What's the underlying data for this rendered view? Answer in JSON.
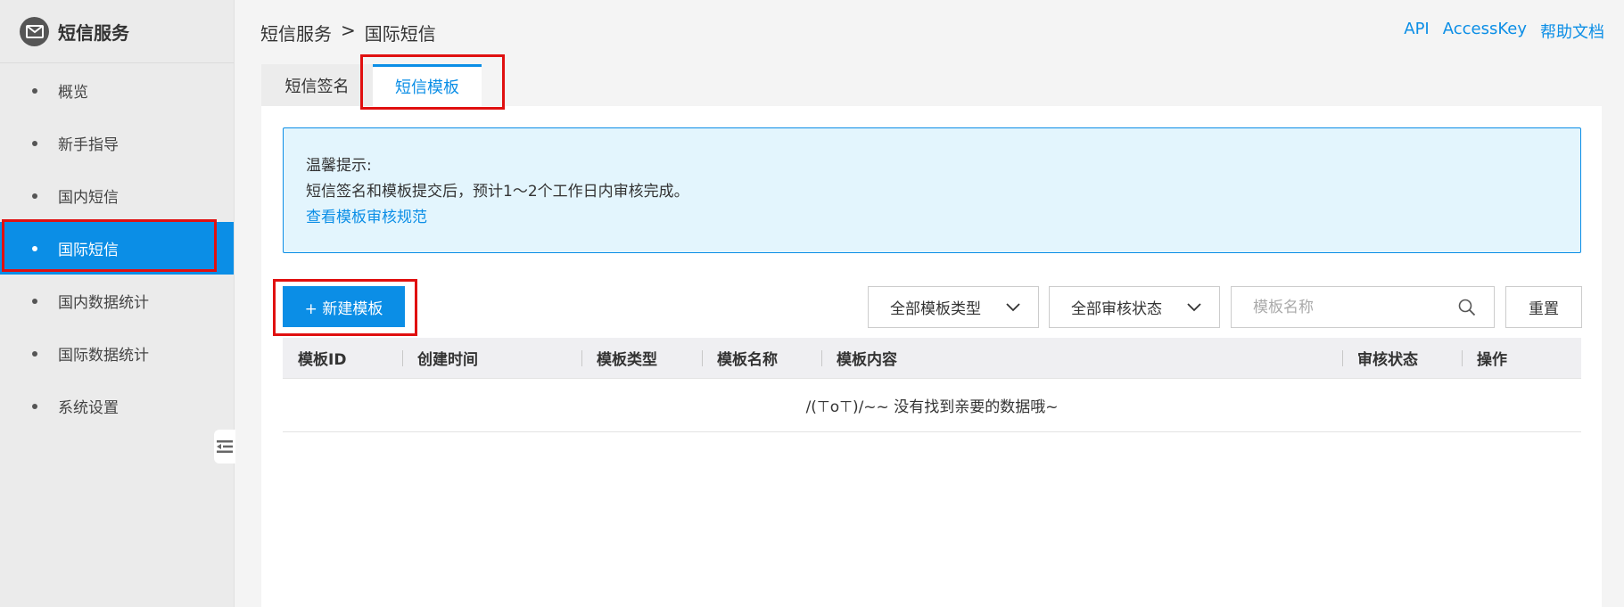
{
  "sidebar": {
    "title": "短信服务",
    "items": [
      {
        "label": "概览",
        "active": false
      },
      {
        "label": "新手指导",
        "active": false
      },
      {
        "label": "国内短信",
        "active": false
      },
      {
        "label": "国际短信",
        "active": true
      },
      {
        "label": "国内数据统计",
        "active": false
      },
      {
        "label": "国际数据统计",
        "active": false
      },
      {
        "label": "系统设置",
        "active": false
      }
    ]
  },
  "breadcrumb": {
    "root": "短信服务",
    "separator": ">",
    "current": "国际短信"
  },
  "top_links": [
    "API",
    "AccessKey",
    "帮助文档"
  ],
  "tabs": [
    {
      "label": "短信签名",
      "active": false
    },
    {
      "label": "短信模板",
      "active": true
    }
  ],
  "notice": {
    "title": "温馨提示:",
    "text": "短信签名和模板提交后，预计1～2个工作日内审核完成。",
    "link": "查看模板审核规范"
  },
  "toolbar": {
    "new_label": "+ 新建模板",
    "type_filter": "全部模板类型",
    "status_filter": "全部审核状态",
    "search_placeholder": "模板名称",
    "reset_label": "重置"
  },
  "table": {
    "columns": [
      "模板ID",
      "创建时间",
      "模板类型",
      "模板名称",
      "模板内容",
      "审核状态",
      "操作"
    ],
    "empty_text": "/(⊤o⊤)/~~ 没有找到亲要的数据哦~"
  },
  "colors": {
    "accent": "#0b8ee6",
    "highlight": "#e01010"
  }
}
